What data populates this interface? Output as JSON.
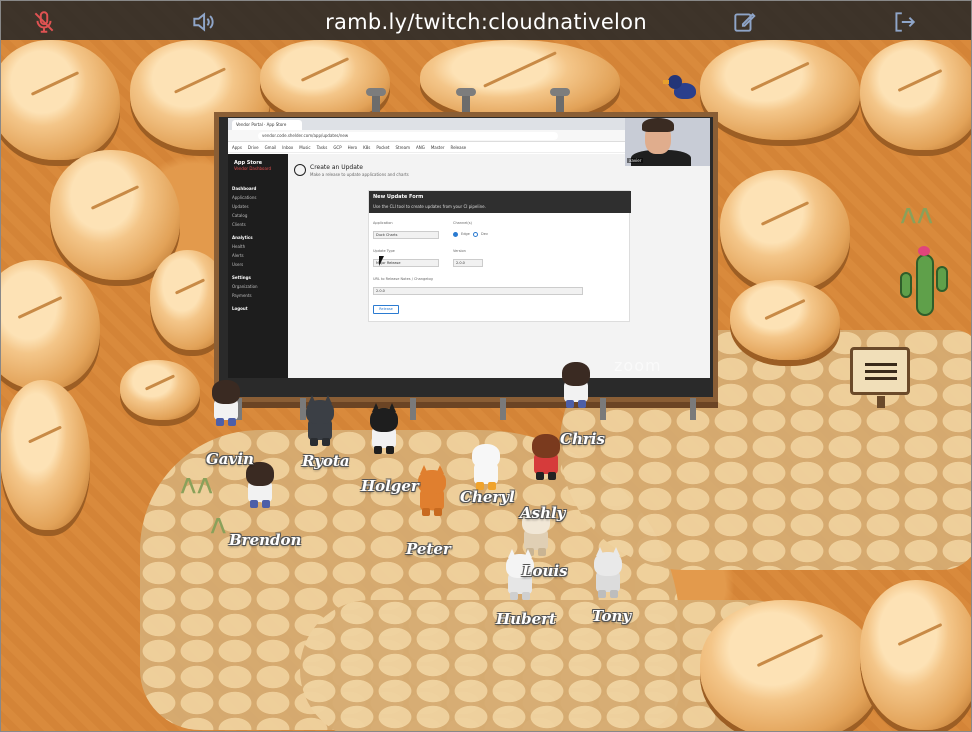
{
  "toolbar": {
    "room_url": "ramb.ly/twitch:cloudnativelon",
    "mic_icon": "microphone-off-icon",
    "speaker_icon": "speaker-icon",
    "edit_icon": "edit-note-icon",
    "exit_icon": "exit-icon",
    "accent_color": "#e05252",
    "icon_color": "#8fa5c8"
  },
  "screen_share": {
    "browser_tab": "Vendor Portal · App Store",
    "url": "vendor.code.shelder.com/app/updates/new",
    "bookmarks": [
      "Apps",
      "Drive",
      "Gmail",
      "Inbox",
      "Music",
      "Tasks",
      "GCP",
      "Hero",
      "K8s",
      "Pocket",
      "Stream",
      "ANG",
      "Master",
      "Release"
    ],
    "sidebar": {
      "brand": "App Store",
      "brand_sub": "Vendor Dashboard",
      "items": [
        {
          "label": "Dashboard",
          "section": true
        },
        {
          "label": "Applications",
          "section": false
        },
        {
          "label": "Updates",
          "section": false
        },
        {
          "label": "Catalog",
          "section": false
        },
        {
          "label": "Clients",
          "section": false
        },
        {
          "label": "Analytics",
          "section": true
        },
        {
          "label": "Health",
          "section": false
        },
        {
          "label": "Alerts",
          "section": false
        },
        {
          "label": "Users",
          "section": false
        },
        {
          "label": "Settings",
          "section": true
        },
        {
          "label": "Organization",
          "section": false
        },
        {
          "label": "Payments",
          "section": false
        },
        {
          "label": "Logout",
          "section": true
        }
      ]
    },
    "page_title": "Create an Update",
    "page_subtitle": "Make a release to update applications and charts",
    "form": {
      "title": "New Update Form",
      "hint": "Use the CLI tool to create updates from your CI pipeline.",
      "application_label": "Application",
      "application_value": "Duck Charts",
      "channel_label": "Channel(s)",
      "channel_options": [
        "Edge",
        "Dev"
      ],
      "update_type_label": "Update Type",
      "update_type_value": "Major Release",
      "version_label": "Version",
      "version_value": "2.0.0",
      "url_label": "URL to Release Notes / Changelog",
      "url_value": "2.0.0",
      "submit_label": "Release"
    },
    "camera_name": "xavier",
    "watermark": "zoom"
  },
  "players": [
    {
      "name": "Gavin",
      "kind": "human"
    },
    {
      "name": "Ryota",
      "kind": "cat-dark"
    },
    {
      "name": "Holger",
      "kind": "cat-black"
    },
    {
      "name": "Chris",
      "kind": "human"
    },
    {
      "name": "Brendon",
      "kind": "human"
    },
    {
      "name": "Cheryl",
      "kind": "duck"
    },
    {
      "name": "Peter",
      "kind": "fox"
    },
    {
      "name": "Ashly",
      "kind": "human-red"
    },
    {
      "name": "Louis",
      "kind": "dog"
    },
    {
      "name": "Hubert",
      "kind": "cat-white"
    },
    {
      "name": "Tony",
      "kind": "cat-glasses"
    }
  ],
  "scenery": {
    "sign": "wooden-sign",
    "creature": "blue-bird",
    "plant": "cactus"
  }
}
